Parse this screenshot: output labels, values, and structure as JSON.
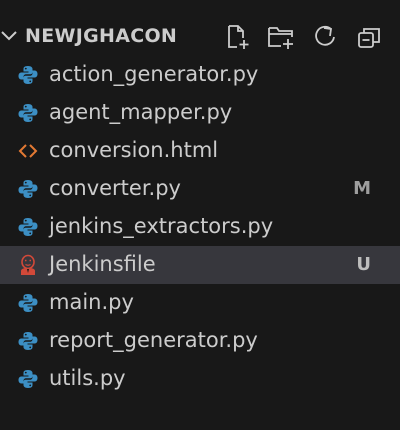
{
  "explorer": {
    "folder_name": "NEWJGHACON",
    "toolbar": [
      {
        "name": "new-file-button",
        "icon": "new-file-icon"
      },
      {
        "name": "new-folder-button",
        "icon": "new-folder-icon"
      },
      {
        "name": "refresh-button",
        "icon": "refresh-icon"
      },
      {
        "name": "collapse-all-button",
        "icon": "collapse-all-icon"
      }
    ],
    "files": [
      {
        "label": "action_generator.py",
        "icon": "python-icon",
        "badge": ""
      },
      {
        "label": "agent_mapper.py",
        "icon": "python-icon",
        "badge": ""
      },
      {
        "label": "conversion.html",
        "icon": "html-icon",
        "badge": ""
      },
      {
        "label": "converter.py",
        "icon": "python-icon",
        "badge": "M"
      },
      {
        "label": "jenkins_extractors.py",
        "icon": "python-icon",
        "badge": ""
      },
      {
        "label": "Jenkinsfile",
        "icon": "jenkins-icon",
        "badge": "U"
      },
      {
        "label": "main.py",
        "icon": "python-icon",
        "badge": ""
      },
      {
        "label": "report_generator.py",
        "icon": "python-icon",
        "badge": ""
      },
      {
        "label": "utils.py",
        "icon": "python-icon",
        "badge": ""
      }
    ],
    "selected_index": 5
  },
  "colors": {
    "background": "#181818",
    "selected_row": "#37373d",
    "text": "#cccccc",
    "python_icon": "#3c8fc4",
    "html_icon": "#e37933",
    "jenkins_icon": "#d24939",
    "badge_modified": "#9e9e9e",
    "badge_untracked": "#bdbdbd"
  }
}
